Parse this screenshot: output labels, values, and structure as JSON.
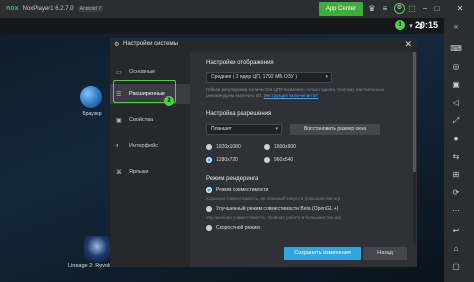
{
  "window": {
    "logo": "nox",
    "version": "NoxPlayer1 6.2.7.0",
    "android": "Android 7",
    "app_center": "App Center"
  },
  "statusbar": {
    "time": "20:15"
  },
  "desktop": {
    "browser_label": "Браузер",
    "lineage_label": "Lineage 2: Revolu"
  },
  "dialog": {
    "title": "Настройки системы",
    "sidebar": [
      {
        "label": "Основные"
      },
      {
        "label": "Расширенные"
      },
      {
        "label": "Свойства"
      },
      {
        "label": "Интерфейс"
      },
      {
        "label": "Ярлыки"
      }
    ],
    "display": {
      "title": "Настройки отображения",
      "cpu_select": "Среднее ( 2 ядер ЦП, 1792 МБ ОЗУ )",
      "hint": "Гибкая регулировка количества ЦПУ возможно только одного, поэтому настоятельно рекомендуем",
      "hint2": "включить ВТ.",
      "hint_link": "Инструкция включения ВТ"
    },
    "resolution": {
      "title": "Настройка разрешения",
      "mode_select": "Планшет",
      "restore_button": "Восстановить размер окна",
      "options": [
        {
          "label": "1920x1080",
          "selected": false
        },
        {
          "label": "1600x900",
          "selected": false
        },
        {
          "label": "1280x720",
          "selected": true
        },
        {
          "label": "960x540",
          "selected": false
        }
      ]
    },
    "render": {
      "title": "Режим рендеринга",
      "options": [
        {
          "label": "Режим совместимости",
          "selected": true,
          "sub": "Хорошая совместимость, но плавный запуск в большинстве игр"
        },
        {
          "label": "Улучшенный режим совместимости Beta (OpenGL +)",
          "selected": false,
          "sub": "Улучшенная совместимость, плавная работа в большинстве игр"
        },
        {
          "label": "Скоростной режим",
          "selected": false,
          "sub": ""
        }
      ]
    },
    "save_button": "Сохранить изменения",
    "cancel_button": "Назад",
    "badge_1": "1",
    "badge_2": "2"
  },
  "colors": {
    "accent": "#2fa6de",
    "highlight": "#4fd04a",
    "app_center": "#3cae3a"
  }
}
